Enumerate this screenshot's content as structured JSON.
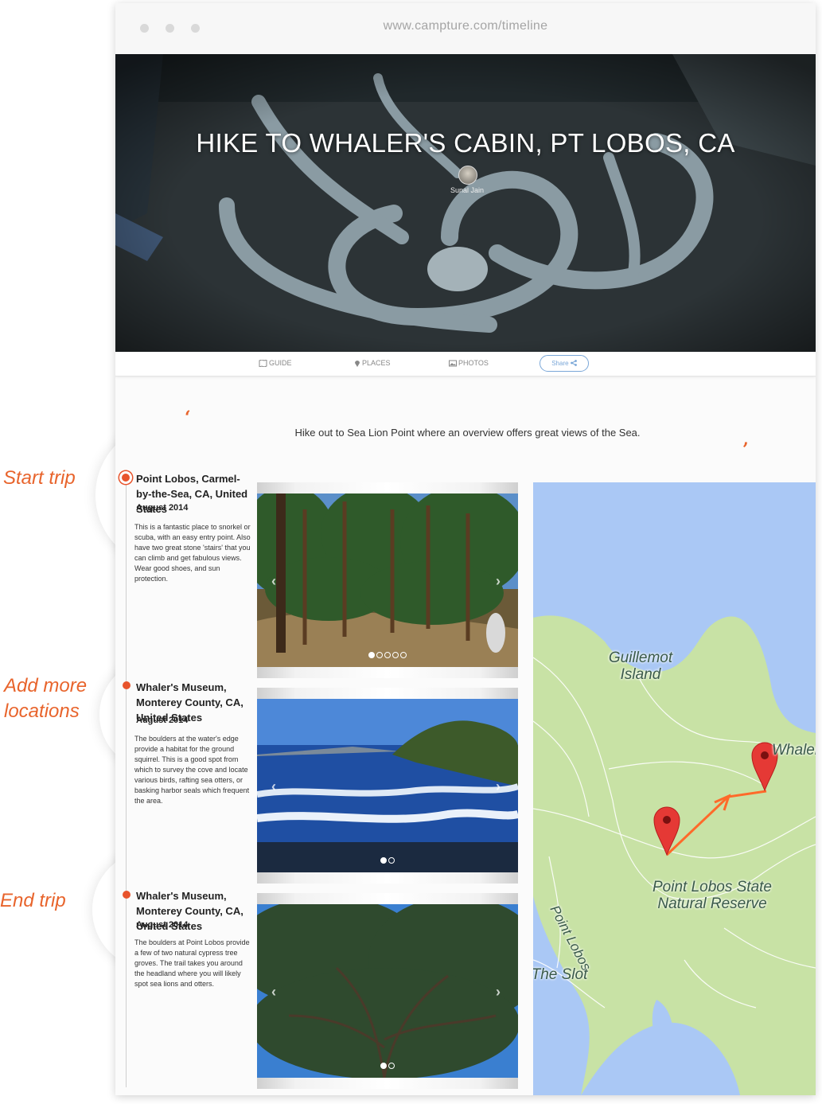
{
  "browser": {
    "url": "www.campture.com/timeline"
  },
  "hero": {
    "title": "HIKE TO WHALER'S CABIN, PT LOBOS, CA",
    "author": "Sunal Jain"
  },
  "tabs": {
    "guide": "GUIDE",
    "places": "PLACES",
    "photos": "PHOTOS",
    "share": "Share"
  },
  "intro": "Hike out to Sea Lion Point where an overview offers great views of the Sea.",
  "side_labels": {
    "start": "Start trip",
    "add_line1": "Add more",
    "add_line2": "locations",
    "end": "End trip"
  },
  "locations": [
    {
      "title": "Point Lobos, Carmel-by-the-Sea, CA, United States",
      "date": "August 2014",
      "description": "This is a fantastic place to snorkel or scuba, with an easy entry point. Also have two great stone 'stairs' that you can climb and get fabulous views. Wear good shoes, and sun protection."
    },
    {
      "title": "Whaler's Museum, Monterey County, CA, United States",
      "date": "August 2014",
      "description": "The boulders at the water's edge provide a habitat for the ground squirrel. This is a good spot from which to survey the cove and locate various birds, rafting sea otters, or basking harbor seals which frequent the area."
    },
    {
      "title": "Whaler's Museum, Monterey County, CA, United States",
      "date": "August 2014",
      "description": "The boulders at Point Lobos provide a few of two natural cypress tree groves. The trail takes you around the headland where you will likely spot sea lions and otters."
    }
  ],
  "map": {
    "labels": {
      "guillemot": "Guillemot Island",
      "reserve": "Point Lobos State Natural Reserve",
      "road": "Point Lobos",
      "slot": "The Slot",
      "whaler": "Whaler"
    },
    "colors": {
      "water": "#aac8f5",
      "land": "#c8e2a5",
      "pin": "#e53935",
      "route": "#ff6a2a"
    }
  },
  "colors": {
    "accent": "#e8642c",
    "share_border": "#7aa7d8"
  }
}
